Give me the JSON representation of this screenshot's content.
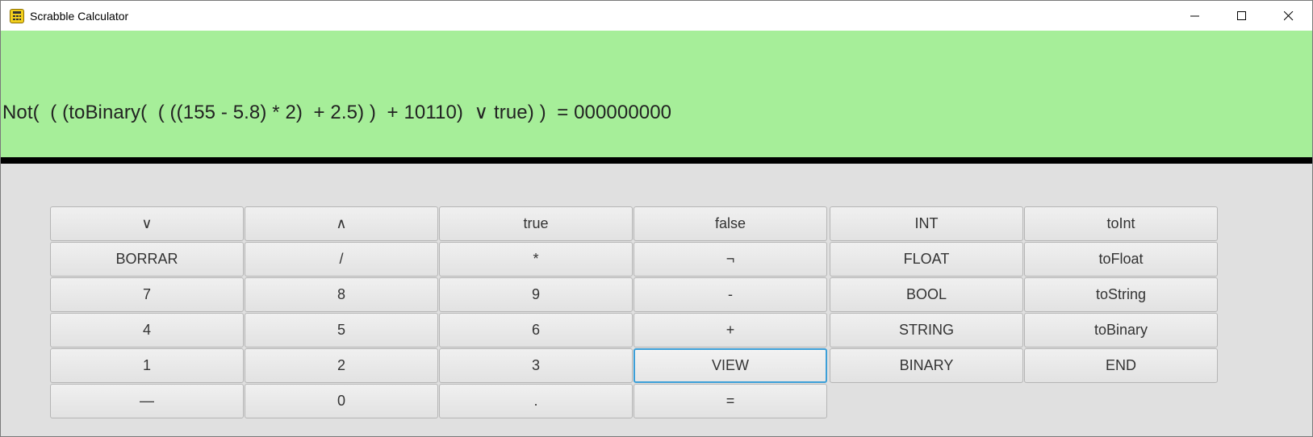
{
  "window": {
    "title": "Scrabble Calculator",
    "controls": [
      "minimize",
      "maximize",
      "close"
    ]
  },
  "display": {
    "expression": "Not(  ( (toBinary(  ( ((155 - 5.8) * 2)  + 2.5) )  + 10110)  ∨ true) )  = 000000000",
    "background": "#a6ee99"
  },
  "keypad": {
    "focused_key": "VIEW",
    "rows": [
      [
        "∨",
        "∧",
        "true",
        "false",
        "INT",
        "toInt"
      ],
      [
        "BORRAR",
        "/",
        "*",
        "¬",
        "FLOAT",
        "toFloat"
      ],
      [
        "7",
        "8",
        "9",
        "-",
        "BOOL",
        "toString"
      ],
      [
        "4",
        "5",
        "6",
        "+",
        "STRING",
        "toBinary"
      ],
      [
        "1",
        "2",
        "3",
        "VIEW",
        "BINARY",
        "END"
      ],
      [
        "—",
        "0",
        ".",
        "="
      ]
    ]
  },
  "colors": {
    "display_bg": "#a6ee99",
    "divider": "#000000",
    "panel_bg": "#e0e0e0",
    "focus_border": "#3c9fd8"
  }
}
